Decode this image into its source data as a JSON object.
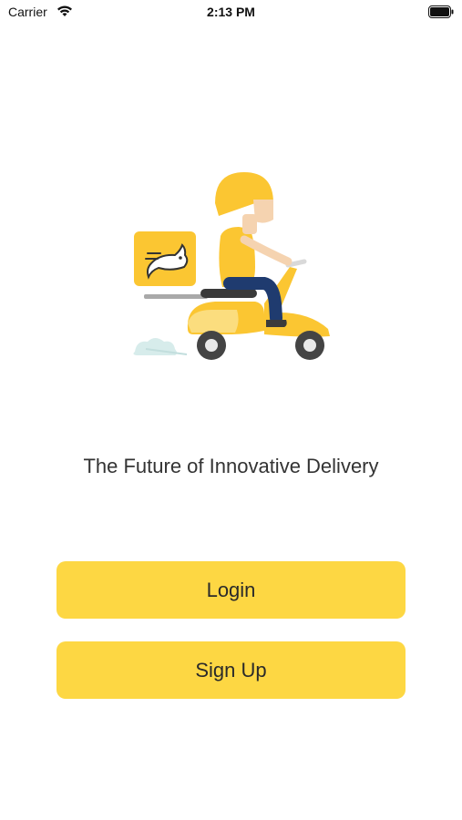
{
  "status_bar": {
    "carrier": "Carrier",
    "time": "2:13 PM",
    "wifi_icon": "wifi-icon",
    "battery_icon": "battery-icon"
  },
  "hero": {
    "illustration": "delivery-scooter-illustration"
  },
  "tagline": "The Future of Innovative Delivery",
  "actions": {
    "login_label": "Login",
    "signup_label": "Sign Up"
  },
  "colors": {
    "accent": "#fdd743",
    "background": "#ffffff"
  }
}
